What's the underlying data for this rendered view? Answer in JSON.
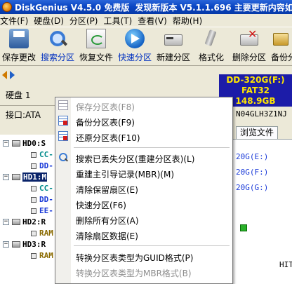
{
  "window": {
    "app_name": "DiskGenius V4.5.0 免费版",
    "notice": "发现新版本 V5.1.1.696 主要更新内容如下：",
    "icon": "diskgenius-app-icon"
  },
  "menu": [
    "文件(F)",
    "硬盘(D)",
    "分区(P)",
    "工具(T)",
    "查看(V)",
    "帮助(H)"
  ],
  "toolbar": [
    {
      "label": "保存更改",
      "icon": "save-icon",
      "highlight": false
    },
    {
      "label": "搜索分区",
      "icon": "search-partition-icon",
      "highlight": true
    },
    {
      "label": "恢复文件",
      "icon": "restore-files-icon",
      "highlight": false
    },
    {
      "label": "快速分区",
      "icon": "quick-partition-icon",
      "highlight": true
    },
    {
      "label": "新建分区",
      "icon": "new-partition-icon",
      "highlight": false
    },
    {
      "label": "格式化",
      "icon": "format-icon",
      "highlight": false
    },
    {
      "label": "删除分区",
      "icon": "delete-partition-icon",
      "highlight": false
    },
    {
      "label": "备份分",
      "icon": "backup-partition-icon",
      "highlight": false
    }
  ],
  "disk_info": {
    "disk_label": "硬盘 1",
    "interface_label": "接口:ATA",
    "serial": "N04GLH3Z1NJ",
    "graphic": {
      "name": "DD-320G(F:)",
      "fs": "FAT32",
      "size": "148.9GB"
    }
  },
  "tabs": {
    "browse_files": "浏览文件"
  },
  "right_list": [
    "20G(E:)",
    "20G(F:)",
    "20G(G:)"
  ],
  "right_hint": "HIT",
  "tree": [
    {
      "label": "HD0:S",
      "kind": "disk",
      "selected": false
    },
    {
      "label": "CC-",
      "kind": "part",
      "color": "teal"
    },
    {
      "label": "DD-",
      "kind": "part",
      "color": "blue"
    },
    {
      "label": "HD1:M",
      "kind": "disk",
      "selected": true
    },
    {
      "label": "CC-",
      "kind": "part",
      "color": "teal"
    },
    {
      "label": "DD-",
      "kind": "part",
      "color": "blue"
    },
    {
      "label": "EE-",
      "kind": "part",
      "color": "blue"
    },
    {
      "label": "HD2:R",
      "kind": "disk",
      "selected": false
    },
    {
      "label": "RAM",
      "kind": "part",
      "color": "olive"
    },
    {
      "label": "HD3:R",
      "kind": "disk",
      "selected": false
    },
    {
      "label": "RAM",
      "kind": "part",
      "color": "olive"
    }
  ],
  "context_menu": {
    "items": [
      {
        "label": "保存分区表(F8)",
        "disabled": true,
        "icon": "save-table-icon"
      },
      {
        "label": "备份分区表(F9)",
        "disabled": false,
        "icon": "backup-table-icon"
      },
      {
        "label": "还原分区表(F10)",
        "disabled": false,
        "icon": "restore-table-icon"
      },
      {
        "label": "搜索已丢失分区(重建分区表)(L)",
        "disabled": false,
        "icon": "search-lost-icon"
      },
      {
        "label": "重建主引导记录(MBR)(M)",
        "disabled": false,
        "icon": ""
      },
      {
        "label": "清除保留扇区(E)",
        "disabled": false,
        "icon": ""
      },
      {
        "label": "快速分区(F6)",
        "disabled": false,
        "icon": ""
      },
      {
        "label": "删除所有分区(A)",
        "disabled": false,
        "icon": ""
      },
      {
        "label": "清除扇区数据(E)",
        "disabled": false,
        "icon": ""
      },
      {
        "label": "转换分区表类型为GUID格式(P)",
        "disabled": false,
        "icon": ""
      },
      {
        "label": "转换分区表类型为MBR格式(B)",
        "disabled": true,
        "icon": ""
      }
    ]
  }
}
